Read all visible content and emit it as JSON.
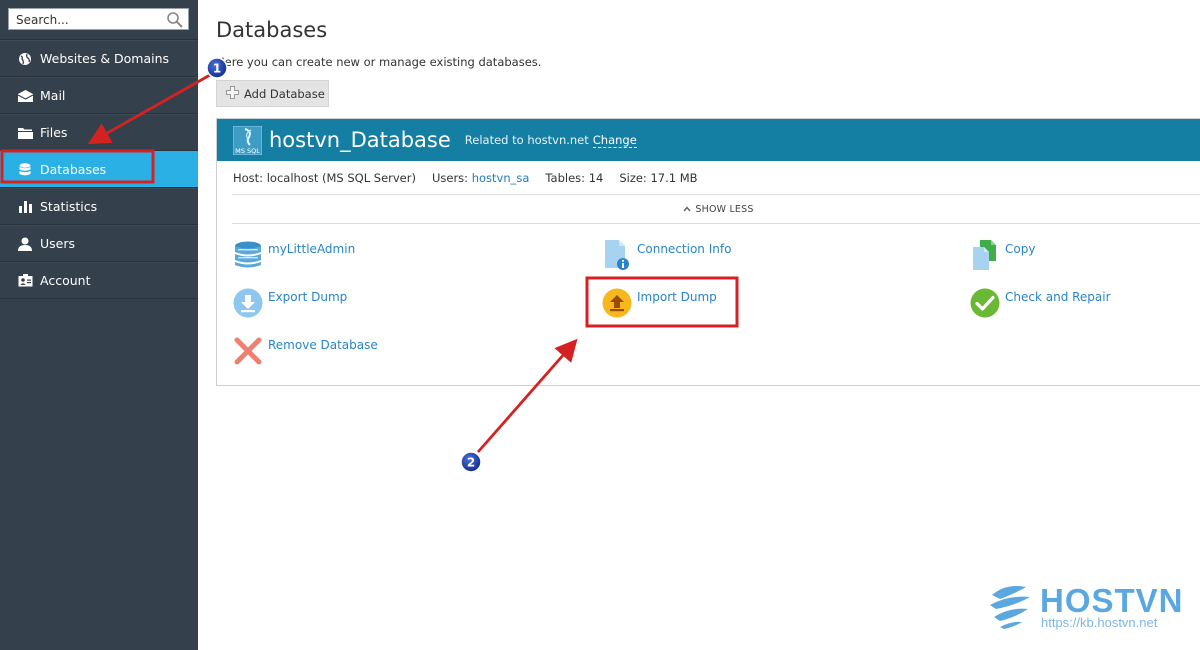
{
  "sidebar": {
    "search_placeholder": "Search...",
    "items": [
      {
        "label": "Websites & Domains",
        "icon": "globe-icon"
      },
      {
        "label": "Mail",
        "icon": "envelope-icon"
      },
      {
        "label": "Files",
        "icon": "folder-icon"
      },
      {
        "label": "Databases",
        "icon": "database-icon",
        "active": true
      },
      {
        "label": "Statistics",
        "icon": "bar-chart-icon"
      },
      {
        "label": "Users",
        "icon": "user-icon"
      },
      {
        "label": "Account",
        "icon": "account-card-icon"
      }
    ]
  },
  "main": {
    "title": "Databases",
    "description": "Here you can create new or manage existing databases.",
    "add_button_label": "Add Database"
  },
  "database": {
    "name": "hostvn_Database",
    "icon_label": "MS SQL",
    "related_text": "Related to hostvn.net",
    "change_label": "Change",
    "host": "Host: localhost (MS SQL Server)",
    "users_label": "Users:",
    "users_value": "hostvn_sa",
    "tables_label": "Tables:",
    "tables_value": "14",
    "size_label": "Size:",
    "size_value": "17.1 MB",
    "show_less_label": "SHOW LESS",
    "actions": [
      {
        "label": "myLittleAdmin",
        "icon": "database-stack-icon"
      },
      {
        "label": "Connection Info",
        "icon": "document-info-icon"
      },
      {
        "label": "Copy",
        "icon": "copy-documents-icon"
      },
      {
        "label": "Export Dump",
        "icon": "download-icon"
      },
      {
        "label": "Import Dump",
        "icon": "upload-icon"
      },
      {
        "label": "Check and Repair",
        "icon": "checkmark-icon"
      },
      {
        "label": "Remove Database",
        "icon": "remove-x-icon"
      }
    ]
  },
  "annotations": {
    "step1": "1",
    "step2": "2",
    "color": "#d42222"
  },
  "watermark": {
    "brand": "HOSTVN",
    "url": "https://kb.hostvn.net"
  },
  "colors": {
    "sidebar_bg": "#34404b",
    "active_nav": "#2bb0e5",
    "db_header": "#157ea3",
    "link": "#2a84c8"
  }
}
